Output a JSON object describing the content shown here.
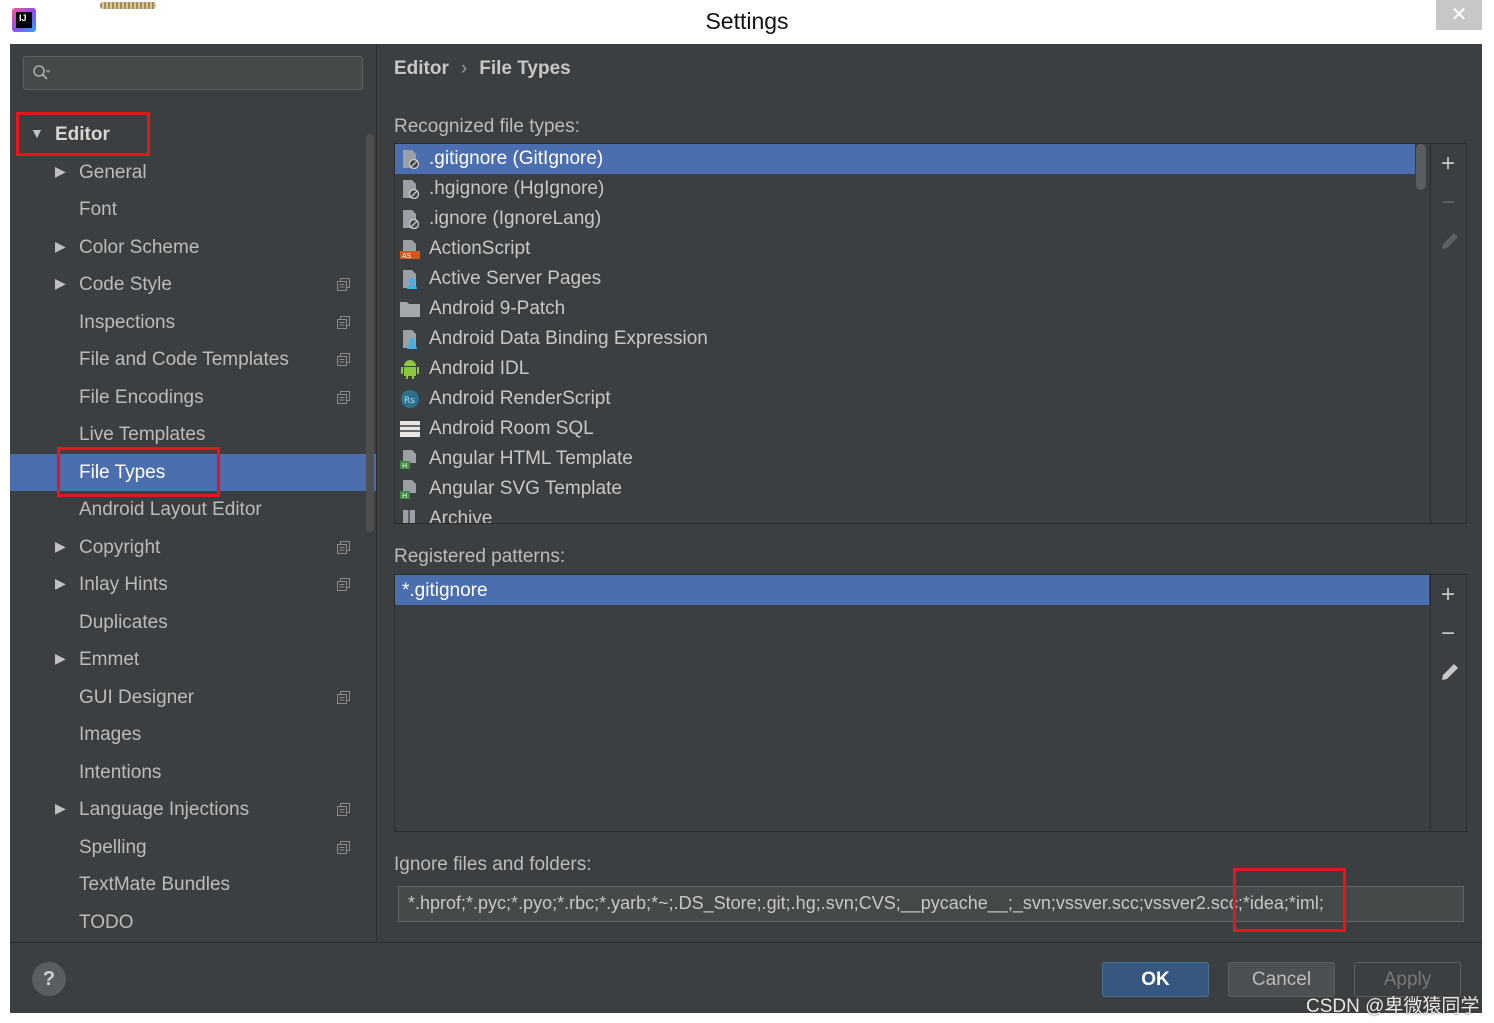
{
  "window": {
    "title": "Settings",
    "close": "✕"
  },
  "sidebar": {
    "items": [
      {
        "label": "Editor",
        "arrow": "▼",
        "bold": true,
        "level": 0,
        "selected": false,
        "copy": false
      },
      {
        "label": "General",
        "arrow": "▶",
        "level": 1,
        "selected": false,
        "copy": false
      },
      {
        "label": "Font",
        "arrow": "",
        "level": 1,
        "selected": false,
        "copy": false
      },
      {
        "label": "Color Scheme",
        "arrow": "▶",
        "level": 1,
        "selected": false,
        "copy": false
      },
      {
        "label": "Code Style",
        "arrow": "▶",
        "level": 1,
        "selected": false,
        "copy": true
      },
      {
        "label": "Inspections",
        "arrow": "",
        "level": 1,
        "selected": false,
        "copy": true
      },
      {
        "label": "File and Code Templates",
        "arrow": "",
        "level": 1,
        "selected": false,
        "copy": true
      },
      {
        "label": "File Encodings",
        "arrow": "",
        "level": 1,
        "selected": false,
        "copy": true
      },
      {
        "label": "Live Templates",
        "arrow": "",
        "level": 1,
        "selected": false,
        "copy": false
      },
      {
        "label": "File Types",
        "arrow": "",
        "level": 1,
        "selected": true,
        "copy": false
      },
      {
        "label": "Android Layout Editor",
        "arrow": "",
        "level": 1,
        "selected": false,
        "copy": false
      },
      {
        "label": "Copyright",
        "arrow": "▶",
        "level": 1,
        "selected": false,
        "copy": true
      },
      {
        "label": "Inlay Hints",
        "arrow": "▶",
        "level": 1,
        "selected": false,
        "copy": true
      },
      {
        "label": "Duplicates",
        "arrow": "",
        "level": 1,
        "selected": false,
        "copy": false
      },
      {
        "label": "Emmet",
        "arrow": "▶",
        "level": 1,
        "selected": false,
        "copy": false
      },
      {
        "label": "GUI Designer",
        "arrow": "",
        "level": 1,
        "selected": false,
        "copy": true
      },
      {
        "label": "Images",
        "arrow": "",
        "level": 1,
        "selected": false,
        "copy": false
      },
      {
        "label": "Intentions",
        "arrow": "",
        "level": 1,
        "selected": false,
        "copy": false
      },
      {
        "label": "Language Injections",
        "arrow": "▶",
        "level": 1,
        "selected": false,
        "copy": true
      },
      {
        "label": "Spelling",
        "arrow": "",
        "level": 1,
        "selected": false,
        "copy": true
      },
      {
        "label": "TextMate Bundles",
        "arrow": "",
        "level": 1,
        "selected": false,
        "copy": false
      },
      {
        "label": "TODO",
        "arrow": "",
        "level": 1,
        "selected": false,
        "copy": false
      }
    ]
  },
  "breadcrumb": {
    "parent": "Editor",
    "separator": "›",
    "current": "File Types"
  },
  "recognized": {
    "label": "Recognized file types:",
    "items": [
      {
        "name": ".gitignore (GitIgnore)",
        "icon": "ignore-file-icon",
        "selected": true
      },
      {
        "name": ".hgignore (HgIgnore)",
        "icon": "ignore-file-icon",
        "selected": false
      },
      {
        "name": ".ignore (IgnoreLang)",
        "icon": "ignore-file-icon",
        "selected": false
      },
      {
        "name": "ActionScript",
        "icon": "actionscript-icon",
        "selected": false
      },
      {
        "name": "Active Server Pages",
        "icon": "asp-file-icon",
        "selected": false
      },
      {
        "name": "Android 9-Patch",
        "icon": "folder-icon",
        "selected": false
      },
      {
        "name": "Android Data Binding Expression",
        "icon": "asp-file-icon",
        "selected": false
      },
      {
        "name": "Android IDL",
        "icon": "android-icon",
        "selected": false
      },
      {
        "name": "Android RenderScript",
        "icon": "renderscript-icon",
        "selected": false
      },
      {
        "name": "Android Room SQL",
        "icon": "table-icon",
        "selected": false
      },
      {
        "name": "Angular HTML Template",
        "icon": "html-file-icon",
        "selected": false
      },
      {
        "name": "Angular SVG Template",
        "icon": "html-file-icon",
        "selected": false
      },
      {
        "name": "Archive",
        "icon": "archive-icon",
        "selected": false
      }
    ]
  },
  "patterns": {
    "label": "Registered patterns:",
    "items": [
      "*.gitignore"
    ]
  },
  "tools": {
    "add": "+",
    "remove": "−",
    "edit": "edit-icon"
  },
  "ignore": {
    "label": "Ignore files and folders:",
    "value": "*.hprof;*.pyc;*.pyo;*.rbc;*.yarb;*~;.DS_Store;.git;.hg;.svn;CVS;__pycache__;_svn;vssver.scc;vssver2.scc;*idea;*iml;"
  },
  "footer": {
    "help": "?",
    "ok": "OK",
    "cancel": "Cancel",
    "apply": "Apply"
  },
  "watermark": "CSDN @卑微猿同学",
  "colors": {
    "selection": "#4b6eaf",
    "panel": "#3c3f41",
    "highlight": "#e8151c"
  }
}
